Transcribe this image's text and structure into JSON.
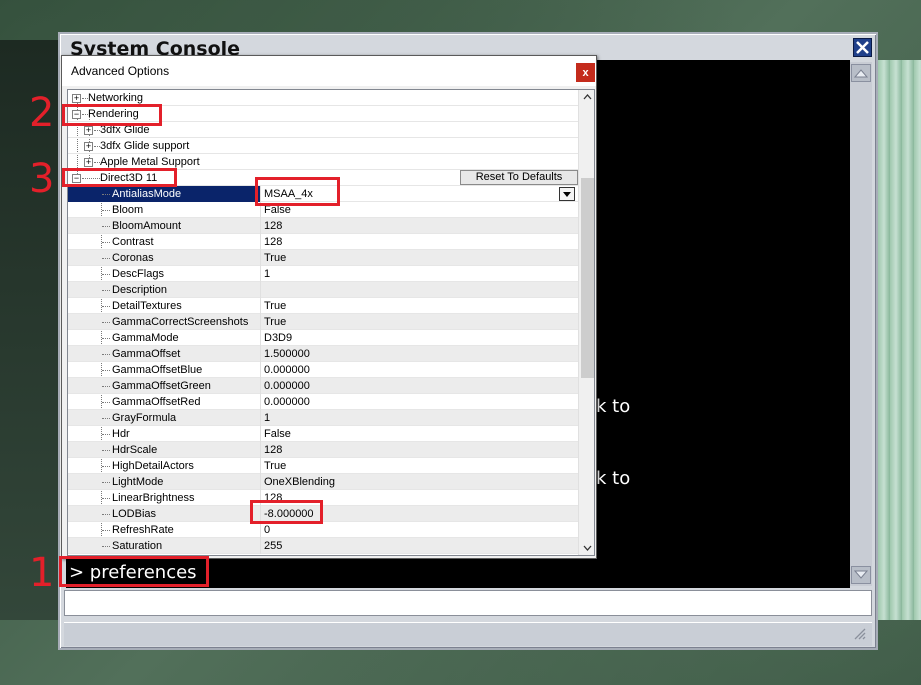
{
  "console": {
    "title": "System Console",
    "prompt": "> preferences",
    "output_fragment_1": "k to",
    "output_fragment_2": "k to",
    "input_value": ""
  },
  "dialog": {
    "title": "Advanced Options",
    "close_label": "x",
    "reset_label": "Reset To Defaults"
  },
  "tree": {
    "categories": [
      {
        "label": "Networking"
      },
      {
        "label": "Rendering"
      },
      {
        "label": "3dfx Glide"
      },
      {
        "label": "3dfx Glide support"
      },
      {
        "label": "Apple Metal Support"
      },
      {
        "label": "Direct3D 11"
      }
    ],
    "properties": [
      {
        "name": "AntialiasMode",
        "value": "MSAA_4x"
      },
      {
        "name": "Bloom",
        "value": "False"
      },
      {
        "name": "BloomAmount",
        "value": "128"
      },
      {
        "name": "Contrast",
        "value": "128"
      },
      {
        "name": "Coronas",
        "value": "True"
      },
      {
        "name": "DescFlags",
        "value": "1"
      },
      {
        "name": "Description",
        "value": ""
      },
      {
        "name": "DetailTextures",
        "value": "True"
      },
      {
        "name": "GammaCorrectScreenshots",
        "value": "True"
      },
      {
        "name": "GammaMode",
        "value": "D3D9"
      },
      {
        "name": "GammaOffset",
        "value": "1.500000"
      },
      {
        "name": "GammaOffsetBlue",
        "value": "0.000000"
      },
      {
        "name": "GammaOffsetGreen",
        "value": "0.000000"
      },
      {
        "name": "GammaOffsetRed",
        "value": "0.000000"
      },
      {
        "name": "GrayFormula",
        "value": "1"
      },
      {
        "name": "Hdr",
        "value": "False"
      },
      {
        "name": "HdrScale",
        "value": "128"
      },
      {
        "name": "HighDetailActors",
        "value": "True"
      },
      {
        "name": "LightMode",
        "value": "OneXBlending"
      },
      {
        "name": "LinearBrightness",
        "value": "128"
      },
      {
        "name": "LODBias",
        "value": "-8.000000"
      },
      {
        "name": "RefreshRate",
        "value": "0"
      },
      {
        "name": "Saturation",
        "value": "255"
      }
    ]
  },
  "annotations": {
    "step_1": "1",
    "step_2": "2",
    "step_3": "3",
    "color": "#e3202a"
  },
  "colors": {
    "selection": "#0a246a",
    "console_bg": "#000000",
    "close_red": "#c42b1c"
  }
}
